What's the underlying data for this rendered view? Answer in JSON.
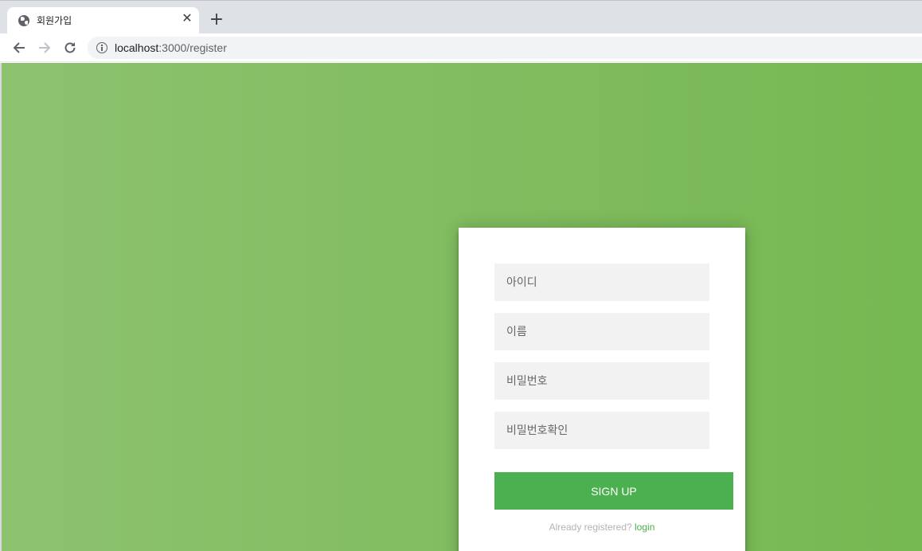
{
  "browser": {
    "tab": {
      "title": "회원가입",
      "close_glyph": "✕",
      "favicon": "globe-icon"
    },
    "new_tab_glyph": "+",
    "address": {
      "host": "localhost",
      "path": ":3000/register"
    }
  },
  "form": {
    "fields": [
      {
        "placeholder": "아이디",
        "type": "text"
      },
      {
        "placeholder": "이름",
        "type": "text"
      },
      {
        "placeholder": "비밀번호",
        "type": "password"
      },
      {
        "placeholder": "비밀번호확인",
        "type": "password"
      }
    ],
    "submit_label": "SIGN UP",
    "message_prefix": "Already registered? ",
    "message_link": "login"
  },
  "colors": {
    "gradient_start": "#8dc26f",
    "gradient_end": "#76b852",
    "accent": "#4caf50"
  }
}
